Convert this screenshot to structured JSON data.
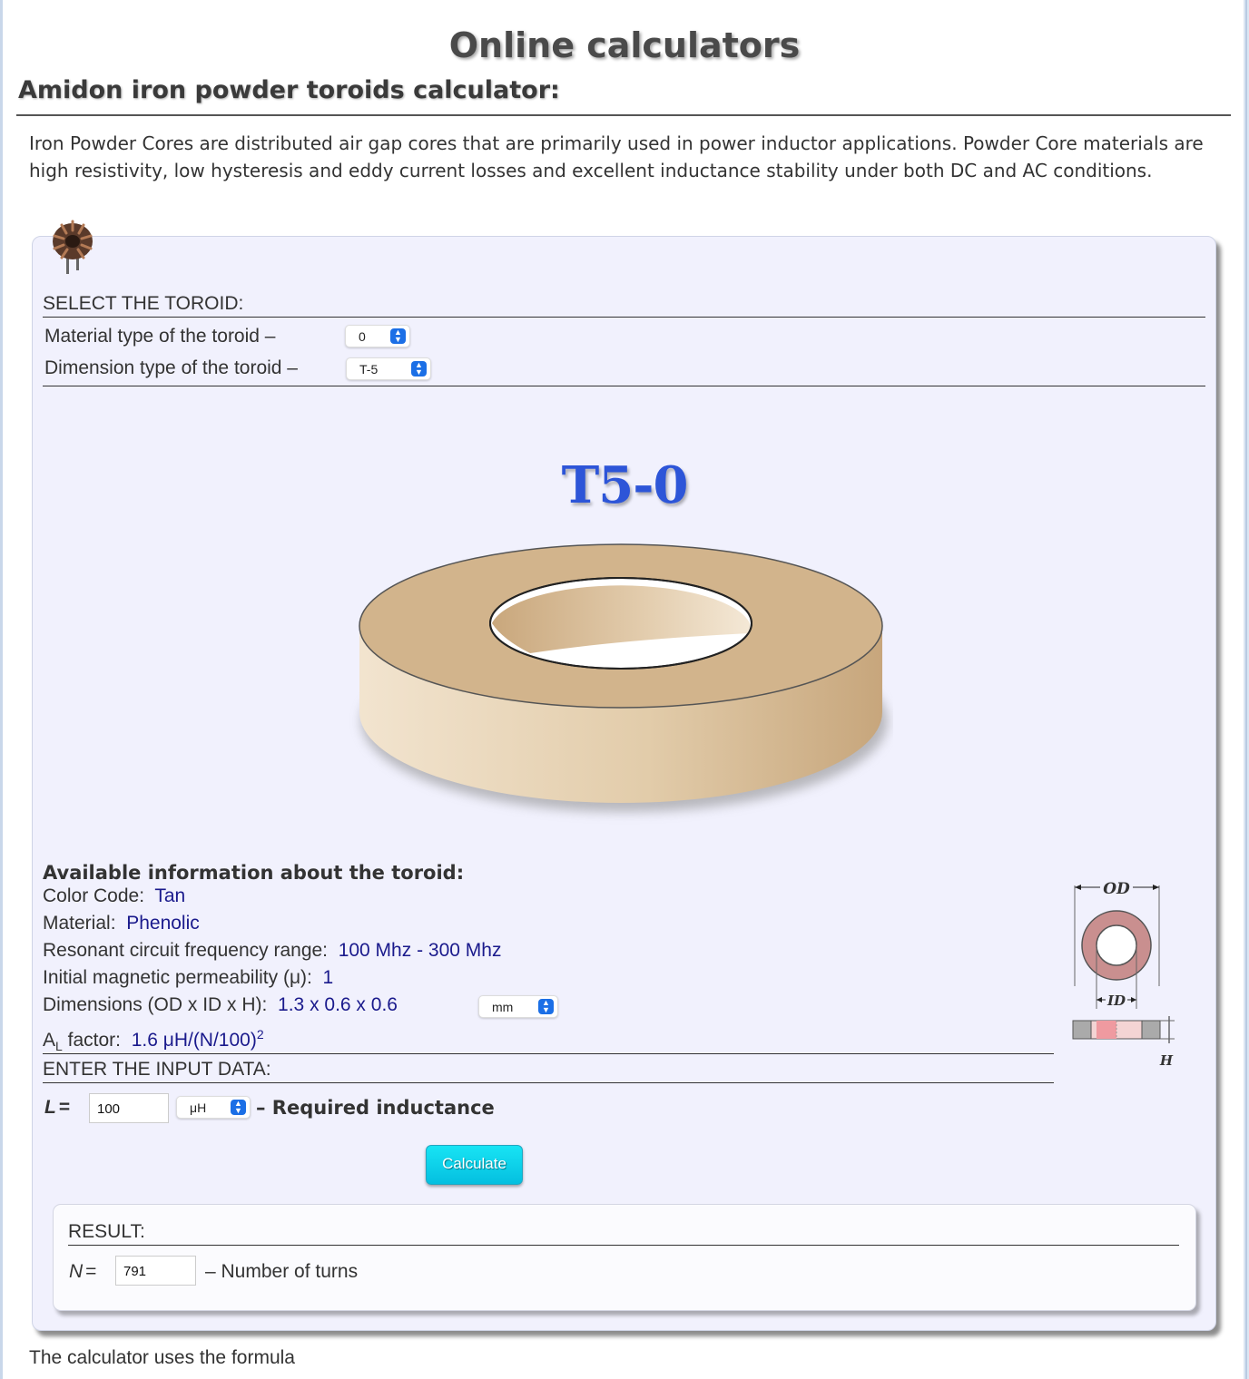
{
  "header": {
    "site_title": "Online calculators",
    "calculator_title": "Amidon iron powder toroids calculator:"
  },
  "intro_text": "Iron Powder Cores are distributed air gap cores that are primarily used in power inductor applications. Powder Core materials are high resistivity, low hysteresis and eddy current losses and excellent inductance stability under both DC and AC conditions.",
  "select_section": {
    "heading": "SELECT THE TOROID:",
    "material_label": "Material type of the toroid –",
    "material_value": "0",
    "dimension_label": "Dimension type of the toroid –",
    "dimension_value": "T-5"
  },
  "toroid": {
    "name": "T5-0",
    "body_color": "#d2b48c"
  },
  "info": {
    "heading": "Available information about the toroid:",
    "color_code_label": "Color Code:",
    "color_code_value": "Tan",
    "material_label": "Material:",
    "material_value": "Phenolic",
    "frequency_label": "Resonant circuit frequency range:",
    "frequency_value": "100 Mhz - 300 Mhz",
    "permeability_label": "Initial magnetic permeability (μ):",
    "permeability_value": "1",
    "dimensions_label": "Dimensions (OD x ID x H):",
    "dimensions_value": "1.3 x 0.6 x 0.6",
    "dimensions_unit": "mm",
    "al_label_main": "A",
    "al_label_sub": "L",
    "al_label_rest": " factor:",
    "al_value": "1.6 μH/(N/100)",
    "al_exponent": "2"
  },
  "diagram": {
    "od_label": "OD",
    "id_label": "ID",
    "h_label": "H"
  },
  "input_section": {
    "heading": "ENTER THE INPUT DATA:",
    "l_label": "L",
    "eq": "=",
    "l_value": "100",
    "l_unit": "μH",
    "l_desc": "– Required inductance",
    "calculate_label": "Calculate"
  },
  "result": {
    "heading": "RESULT:",
    "n_label": "N",
    "eq": "=",
    "n_value": "791",
    "n_desc": "– Number of turns"
  },
  "footer_text": "The calculator uses the formula",
  "colors": {
    "panel_bg": "#f1f1fd",
    "value_text": "#1a1a8c",
    "toroid_title": "#2d55d8",
    "button": "#0ccde8",
    "select_arrow": "#1b6fe6"
  }
}
